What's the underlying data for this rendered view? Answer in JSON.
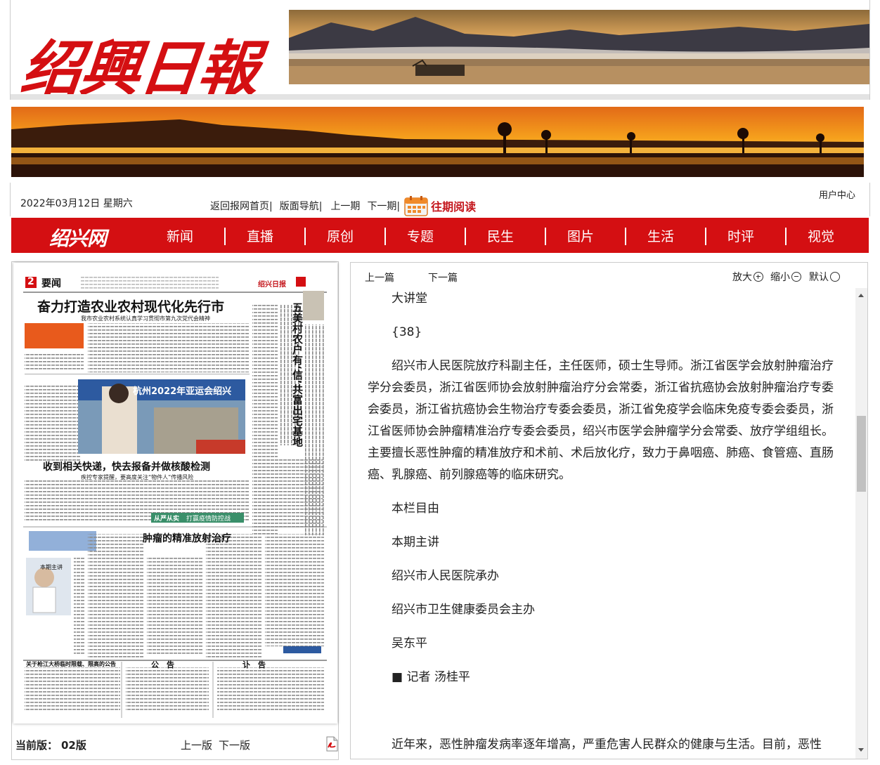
{
  "masthead": {
    "logo_text": "绍興日報"
  },
  "infobar": {
    "date": "2022年03月12日 星期六",
    "nav": [
      "返回报网首页|",
      "版面导航|",
      "上一期",
      "下一期|"
    ],
    "archive_label": "往期阅读",
    "user_center": "用户中心"
  },
  "channelbar": {
    "site_logo": "绍兴网",
    "channels": [
      "新闻",
      "直播",
      "原创",
      "专题",
      "民生",
      "图片",
      "生活",
      "时评",
      "视觉"
    ]
  },
  "thumbnail": {
    "page_no": "2",
    "page_section": "要闻",
    "paper_name": "绍兴日报",
    "headline_1": "奋力打造农业农村现代化先行市",
    "subhead_1": "我市农业农村系统认真学习贯彻市第九次党代会精神",
    "headline_vertical": "五美村农户有‘信’共富出宅基地",
    "photo_banner": "杭州2022年亚运会绍兴",
    "headline_2": "收到相关快递，快去报备并做核酸检测",
    "subhead_2": "疾控专家提醒，要高度关注“物件人”传播风险",
    "tag_1": "从严从实",
    "tag_1b": "打赢疫情防控战",
    "headline_3": "肿瘤的精准放射治疗",
    "column_tag": "本期主讲",
    "notice_1": "关于枪江大桥临时限载、限高的公告",
    "notice_2": "公　告",
    "notice_3": "讣　告"
  },
  "pagebar": {
    "current_label": "当前版：",
    "current_value": "02版",
    "prev": "上一版",
    "next": "下一版"
  },
  "article_toolbar": {
    "prev": "上一篇",
    "next": "下一篇",
    "zoom_in": "放大",
    "zoom_out": "缩小",
    "zoom_default": "默认"
  },
  "article": {
    "paragraphs": [
      "大讲堂",
      "{38}",
      "绍兴市人民医院放疗科副主任，主任医师，硕士生导师。浙江省医学会放射肿瘤治疗学分会委员，浙江省医师协会放射肿瘤治疗分会常委，浙江省抗癌协会放射肿瘤治疗专委会委员，浙江省抗癌协会生物治疗专委会委员，浙江省免疫学会临床免疫专委会委员，浙江省医师协会肿瘤精准治疗专委会委员，绍兴市医学会肿瘤学分会常委、放疗学组组长。主要擅长恶性肿瘤的精准放疗和术前、术后放化疗，致力于鼻咽癌、肺癌、食管癌、直肠癌、乳腺癌、前列腺癌等的临床研究。",
      "本栏目由",
      "本期主讲",
      "绍兴市人民医院承办",
      "绍兴市卫生健康委员会主办",
      "吴东平",
      "■ 记者 汤桂平",
      "",
      "近年来，恶性肿瘤发病率逐年增高，严重危害人民群众的健康与生活。目前，恶性"
    ]
  },
  "colors": {
    "brand_red": "#d40f12",
    "archive_red": "#c4161c"
  }
}
